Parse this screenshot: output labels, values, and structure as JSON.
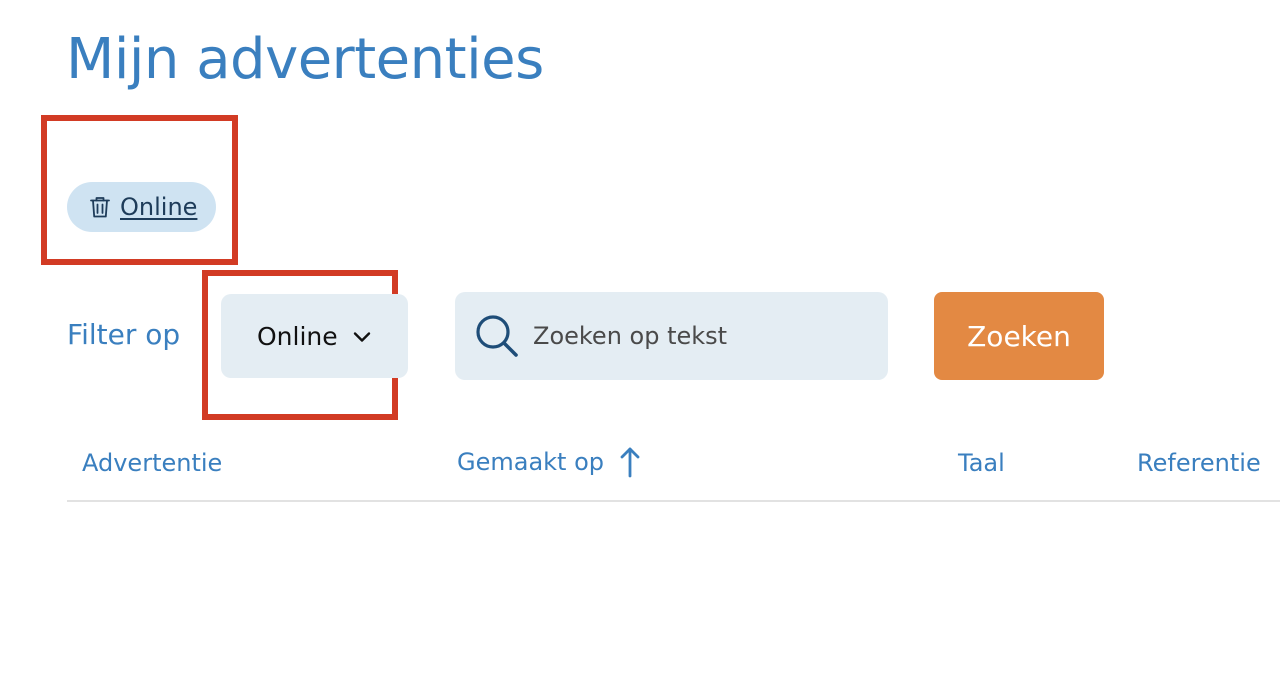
{
  "page": {
    "title": "Mijn advertenties"
  },
  "active_filter_chip": {
    "label": "Online",
    "icon": "trash-icon"
  },
  "filter": {
    "label": "Filter op",
    "selected_value": "Online",
    "icon": "chevron-down-icon"
  },
  "search": {
    "value": "",
    "placeholder": "Zoeken op tekst",
    "icon": "search-icon",
    "button_label": "Zoeken"
  },
  "table": {
    "columns": [
      {
        "label": "Advertentie"
      },
      {
        "label": "Gemaakt op",
        "sort": "ascending",
        "icon": "arrow-up-icon"
      },
      {
        "label": "Taal"
      },
      {
        "label": "Referentie"
      }
    ],
    "rows": []
  },
  "colors": {
    "primary_blue": "#3a7fbf",
    "chip_background": "#cfe3f2",
    "input_background": "#e4edf3",
    "accent_orange": "#e38943",
    "highlight_red": "#d23b24"
  }
}
